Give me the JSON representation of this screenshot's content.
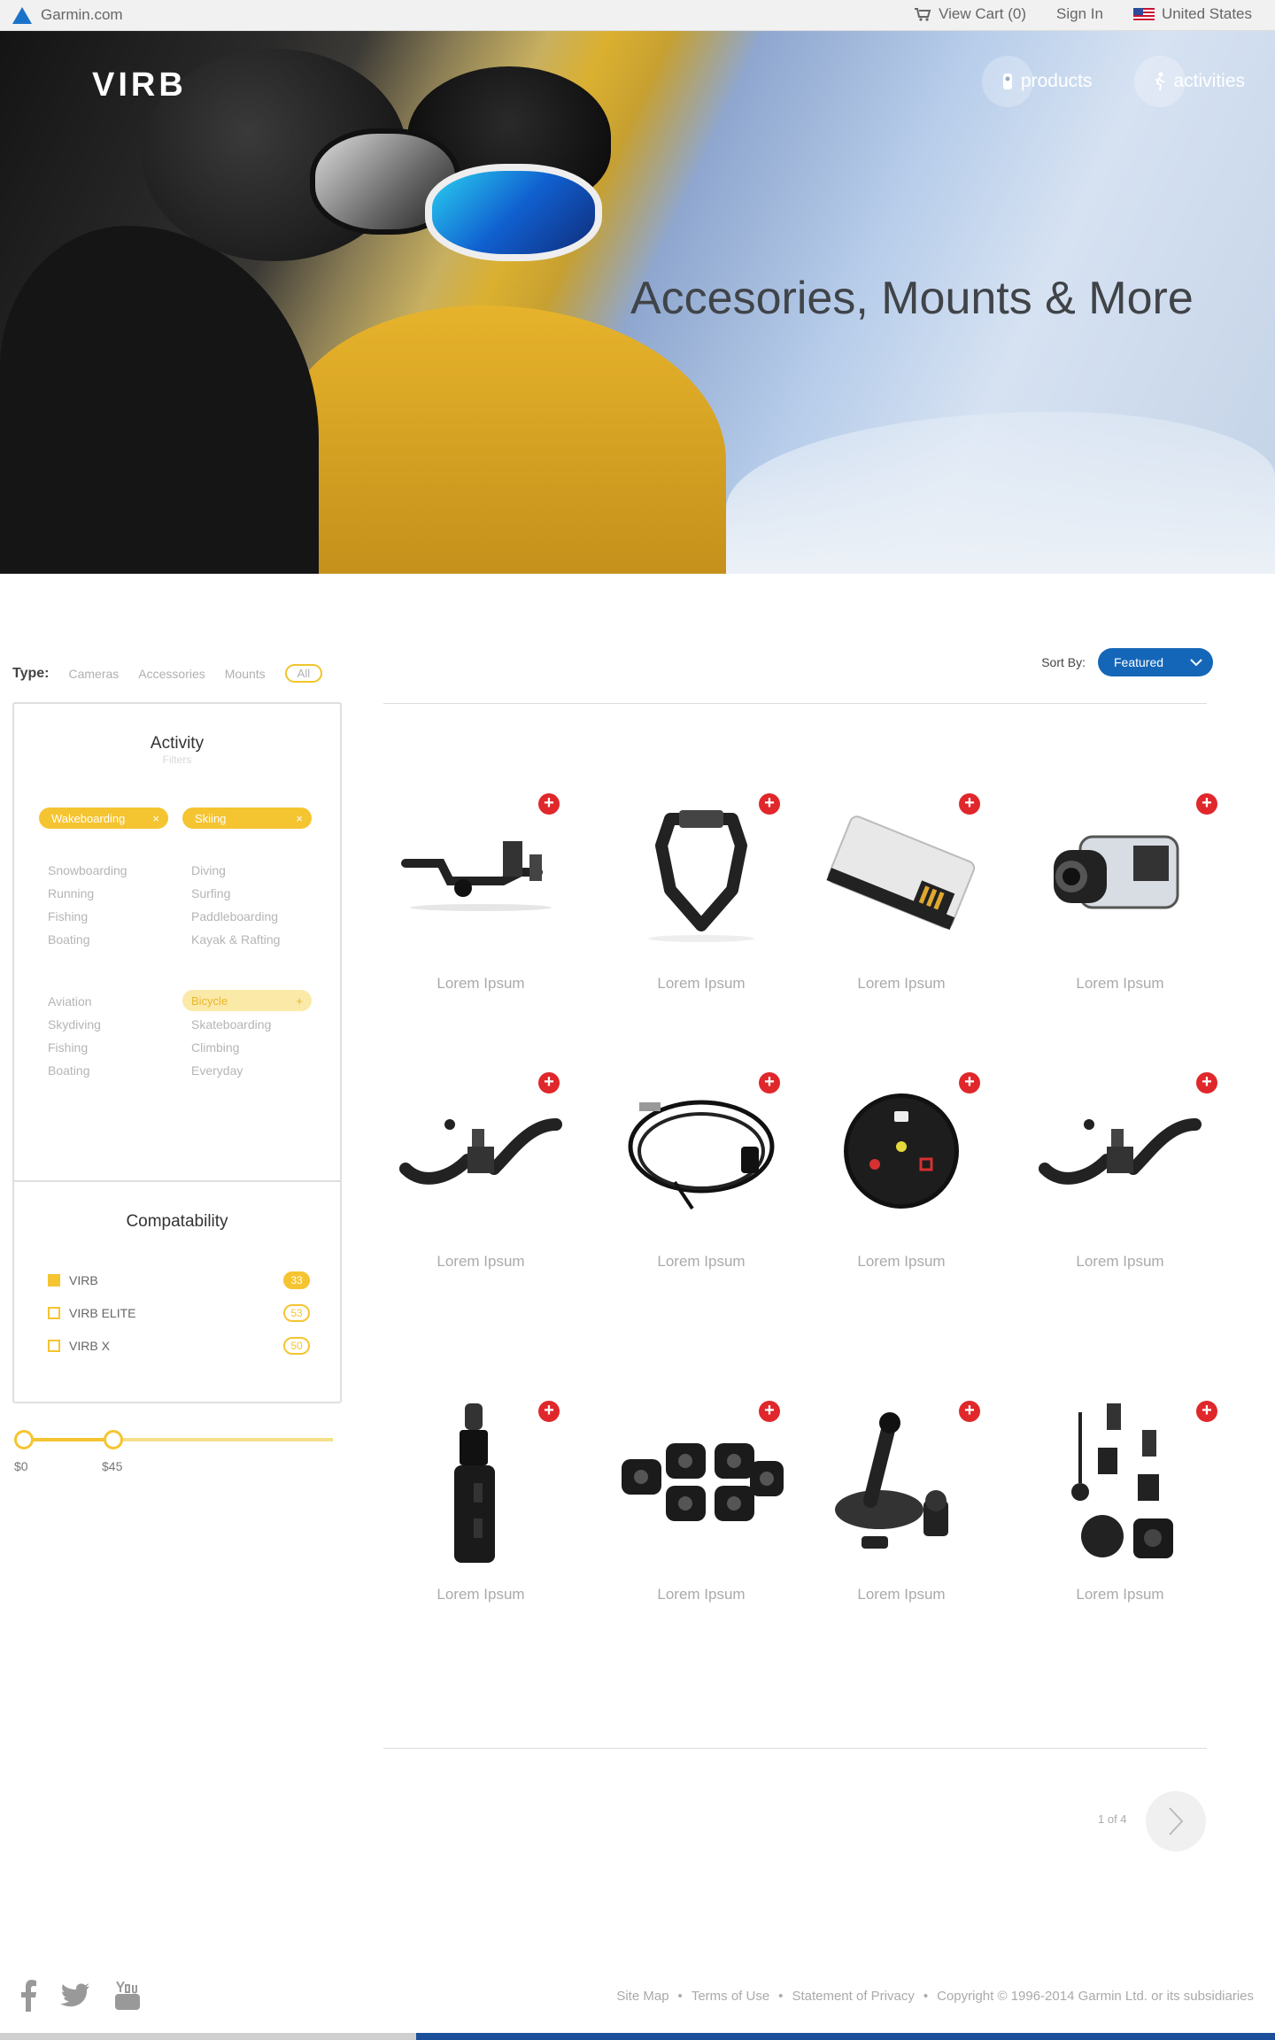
{
  "topbar": {
    "site": "Garmin.com",
    "cart": "View Cart (0)",
    "signin": "Sign In",
    "region": "United States"
  },
  "hero": {
    "logo": "VIRB",
    "nav": [
      "products",
      "activities"
    ],
    "title": "Accesories, Mounts & More"
  },
  "filters": {
    "type_label": "Type:",
    "types": [
      "Cameras",
      "Accessories",
      "Mounts",
      "All"
    ],
    "sort_label": "Sort By:",
    "sort_value": "Featured"
  },
  "activity": {
    "title": "Activity",
    "subtitle": "Filters",
    "selected": [
      "Wakeboarding",
      "Skiing"
    ],
    "group1_left": [
      "Snowboarding",
      "Running",
      "Fishing",
      "Boating"
    ],
    "group1_right": [
      "Diving",
      "Surfing",
      "Paddleboarding",
      "Kayak & Rafting"
    ],
    "group2_left": [
      "Aviation",
      "Skydiving",
      "Fishing",
      "Boating"
    ],
    "group2_right": [
      "Bicycle",
      "Skateboarding",
      "Climbing",
      "Everyday"
    ]
  },
  "compat": {
    "title": "Compatability",
    "items": [
      {
        "label": "VIRB",
        "count": "33",
        "checked": true
      },
      {
        "label": "VIRB ELITE",
        "count": "53",
        "checked": false
      },
      {
        "label": "VIRB X",
        "count": "50",
        "checked": false
      }
    ]
  },
  "price": {
    "min": "$0",
    "max": "$45",
    "range_fraction": 0.3
  },
  "products": [
    {
      "name": "Lorem Ipsum",
      "icon": "handlebar-mount"
    },
    {
      "name": "Lorem Ipsum",
      "icon": "chest-harness"
    },
    {
      "name": "Lorem Ipsum",
      "icon": "battery"
    },
    {
      "name": "Lorem Ipsum",
      "icon": "dive-case"
    },
    {
      "name": "Lorem Ipsum",
      "icon": "strap-mount"
    },
    {
      "name": "Lorem Ipsum",
      "icon": "usb-cable"
    },
    {
      "name": "Lorem Ipsum",
      "icon": "remote"
    },
    {
      "name": "Lorem Ipsum",
      "icon": "strap-mount"
    },
    {
      "name": "Lorem Ipsum",
      "icon": "car-charger"
    },
    {
      "name": "Lorem Ipsum",
      "icon": "adhesive-mounts"
    },
    {
      "name": "Lorem Ipsum",
      "icon": "suction-mount"
    },
    {
      "name": "Lorem Ipsum",
      "icon": "mount-kit"
    }
  ],
  "pagination": {
    "label": "1 of 4"
  },
  "footer": {
    "links": [
      "Site Map",
      "•",
      "Terms of Use",
      "•",
      "Statement of Privacy",
      "•",
      "Copyright © 1996-2014 Garmin Ltd. or its subsidiaries"
    ]
  },
  "colors": {
    "accent": "#f5c431",
    "brand_blue": "#1466b8",
    "add_red": "#e0272b"
  }
}
